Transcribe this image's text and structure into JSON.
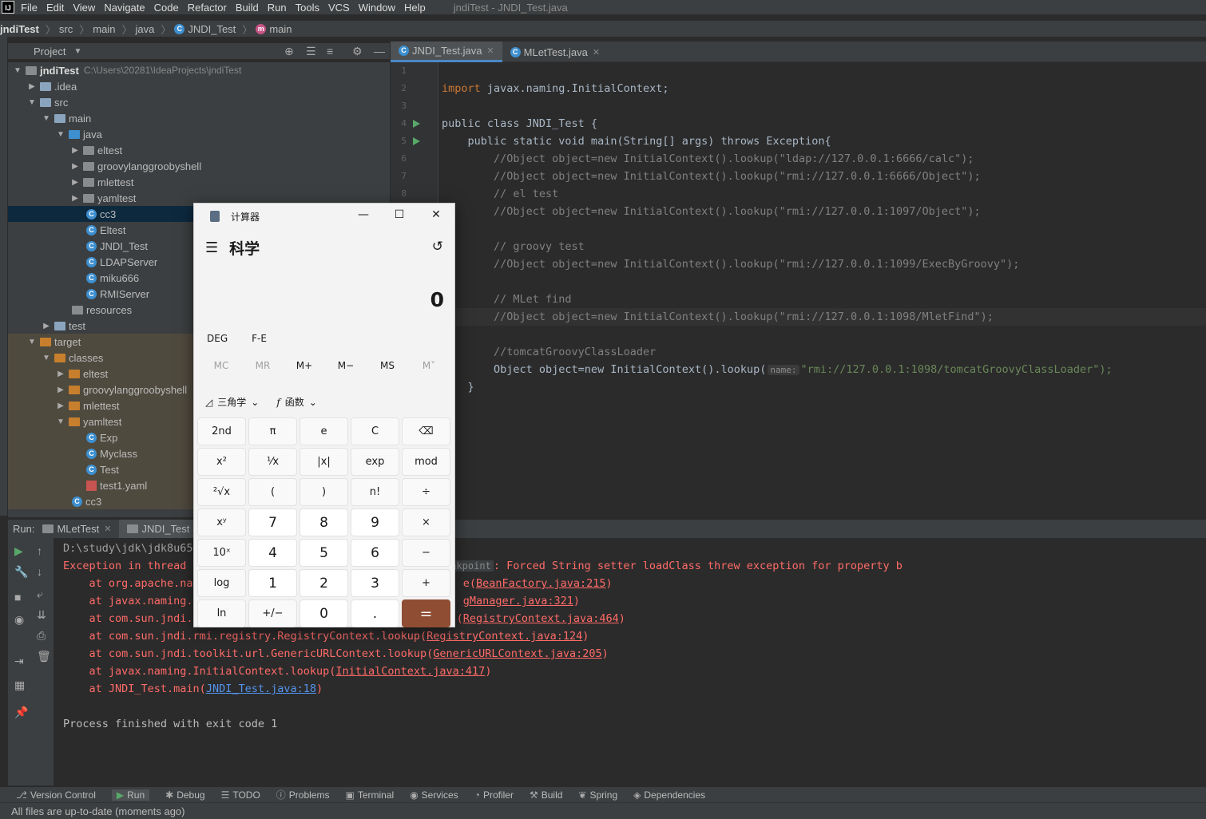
{
  "menu": {
    "items": [
      "File",
      "Edit",
      "View",
      "Navigate",
      "Code",
      "Refactor",
      "Build",
      "Run",
      "Tools",
      "VCS",
      "Window",
      "Help"
    ],
    "window_title": "jndiTest - JNDI_Test.java"
  },
  "breadcrumb": {
    "items": [
      "jndiTest",
      "src",
      "main",
      "java",
      "JNDI_Test",
      "main"
    ]
  },
  "project_panel": {
    "title": "Project",
    "root_name": "jndiTest",
    "root_path": "C:\\Users\\20281\\IdeaProjects\\jndiTest",
    "tree": [
      {
        "label": "jndiTest",
        "depth": 0,
        "type": "root"
      },
      {
        "label": ".idea",
        "depth": 1,
        "type": "folder"
      },
      {
        "label": "src",
        "depth": 1,
        "type": "folder"
      },
      {
        "label": "main",
        "depth": 2,
        "type": "folder"
      },
      {
        "label": "java",
        "depth": 3,
        "type": "folder"
      },
      {
        "label": "eltest",
        "depth": 4,
        "type": "package"
      },
      {
        "label": "groovylanggroobyshell",
        "depth": 4,
        "type": "package"
      },
      {
        "label": "mlettest",
        "depth": 4,
        "type": "package"
      },
      {
        "label": "yamltest",
        "depth": 4,
        "type": "package"
      },
      {
        "label": "cc3",
        "depth": 4,
        "type": "class"
      },
      {
        "label": "Eltest",
        "depth": 4,
        "type": "class"
      },
      {
        "label": "JNDI_Test",
        "depth": 4,
        "type": "class"
      },
      {
        "label": "LDAPServer",
        "depth": 4,
        "type": "class"
      },
      {
        "label": "miku666",
        "depth": 4,
        "type": "class"
      },
      {
        "label": "RMIServer",
        "depth": 4,
        "type": "class"
      },
      {
        "label": "resources",
        "depth": 3,
        "type": "folder"
      },
      {
        "label": "test",
        "depth": 2,
        "type": "folder"
      },
      {
        "label": "target",
        "depth": 1,
        "type": "folder-orange"
      },
      {
        "label": "classes",
        "depth": 2,
        "type": "folder-orange"
      },
      {
        "label": "eltest",
        "depth": 3,
        "type": "folder-orange"
      },
      {
        "label": "groovylanggroobyshell",
        "depth": 3,
        "type": "folder-orange"
      },
      {
        "label": "mlettest",
        "depth": 3,
        "type": "folder-orange"
      },
      {
        "label": "yamltest",
        "depth": 3,
        "type": "folder-orange"
      },
      {
        "label": "Exp",
        "depth": 4,
        "type": "class"
      },
      {
        "label": "Myclass",
        "depth": 4,
        "type": "class"
      },
      {
        "label": "Test",
        "depth": 4,
        "type": "class"
      },
      {
        "label": "test1.yaml",
        "depth": 4,
        "type": "yaml"
      },
      {
        "label": "cc3",
        "depth": 3,
        "type": "class"
      }
    ]
  },
  "editor": {
    "tabs": [
      {
        "label": "JNDI_Test.java",
        "active": true
      },
      {
        "label": "MLetTest.java",
        "active": false
      }
    ],
    "line_numbers": [
      "1",
      "2",
      "3",
      "4",
      "5",
      "6",
      "7",
      "8"
    ],
    "lines": [
      "",
      "import javax.naming.InitialContext;",
      "",
      "public class JNDI_Test {",
      "    public static void main(String[] args) throws Exception{",
      "        //Object object=new InitialContext().lookup(\"ldap://127.0.0.1:6666/calc\");",
      "        //Object object=new InitialContext().lookup(\"rmi://127.0.0.1:6666/Object\");",
      "        // el test",
      "        //Object object=new InitialContext().lookup(\"rmi://127.0.0.1:1097/Object\");",
      "",
      "        // groovy test",
      "        //Object object=new InitialContext().lookup(\"rmi://127.0.0.1:1099/ExecByGroovy\");",
      "",
      "        // MLet find",
      "        //Object object=new InitialContext().lookup(\"rmi://127.0.0.1:1098/MletFind\");",
      "",
      "        //tomcatGroovyClassLoader",
      "        Object object=new InitialContext().lookup(",
      "    }"
    ],
    "param_hint": "name:",
    "last_string": "\"rmi://127.0.0.1:1098/tomcatGroovyClassLoader\");"
  },
  "run_panel": {
    "label": "Run:",
    "tabs": [
      "MLetTest",
      "JNDI_Test"
    ],
    "console": {
      "cmd": "D:\\study\\jdk\\jdk8u65",
      "exc_head": "Exception in thread ",
      "breakpoint": "Breakpoint",
      "exc_msg": ": Forced String setter loadClass threw exception for property b",
      "frames": [
        {
          "text": "    at org.apache.nam",
          "tail": "e(",
          "link": "BeanFactory.java:215",
          "end": ")"
        },
        {
          "text": "    at javax.naming.s",
          "tail": "",
          "link": "gManager.java:321",
          "end": ")"
        },
        {
          "text": "    at com.sun.jndi.",
          "tail": "(",
          "link": "RegistryContext.java:464",
          "end": ")"
        },
        {
          "text": "    at com.sun.jndi.rmi.registry.RegistryContext.lookup(",
          "tail": "",
          "link": "RegistryContext.java:124",
          "end": ")"
        },
        {
          "text": "    at com.sun.jndi.toolkit.url.GenericURLContext.lookup(",
          "tail": "",
          "link": "GenericURLContext.java:205",
          "end": ")"
        },
        {
          "text": "    at javax.naming.InitialContext.lookup(",
          "tail": "",
          "link": "InitialContext.java:417",
          "end": ")"
        },
        {
          "text": "    at JNDI_Test.main(",
          "tail": "",
          "link": "JNDI_Test.java:18",
          "end": ")"
        }
      ],
      "exit": "Process finished with exit code 1"
    }
  },
  "bottom_tools": [
    "Version Control",
    "Run",
    "Debug",
    "TODO",
    "Problems",
    "Terminal",
    "Services",
    "Profiler",
    "Build",
    "Spring",
    "Dependencies"
  ],
  "status": "All files are up-to-date (moments ago)",
  "calculator": {
    "title": "计算器",
    "mode": "科学",
    "display": "0",
    "angle": "DEG",
    "fe": "F-E",
    "memory": [
      "MC",
      "MR",
      "M+",
      "M−",
      "MS",
      "M˅"
    ],
    "trig": "三角学",
    "func": "函数",
    "keys": [
      "2nd",
      "π",
      "e",
      "C",
      "⌫",
      "x²",
      "¹⁄x",
      "|x|",
      "exp",
      "mod",
      "²√x",
      "(",
      ")",
      "n!",
      "÷",
      "xʸ",
      "7",
      "8",
      "9",
      "×",
      "10ˣ",
      "4",
      "5",
      "6",
      "−",
      "log",
      "1",
      "2",
      "3",
      "+",
      "ln",
      "+/−",
      "0",
      ".",
      "="
    ]
  },
  "colors": {
    "accent": "#4a88c7",
    "equals_key": "#8f4d33",
    "error_text": "#ff6b68"
  }
}
